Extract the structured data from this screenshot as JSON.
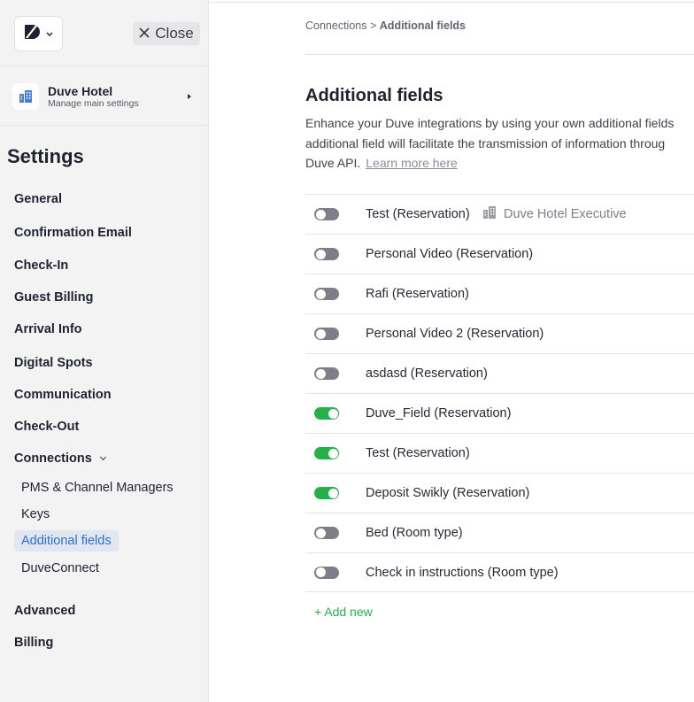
{
  "sidebar": {
    "close_label": "Close",
    "hotel": {
      "name": "Duve Hotel",
      "subtitle": "Manage main settings"
    },
    "title": "Settings",
    "items": [
      {
        "label": "General"
      },
      {
        "label": "Confirmation Email"
      },
      {
        "label": "Check-In"
      },
      {
        "label": "Guest Billing"
      },
      {
        "label": "Arrival Info"
      },
      {
        "label": "Digital Spots"
      },
      {
        "label": "Communication"
      },
      {
        "label": "Check-Out"
      },
      {
        "label": "Connections",
        "expanded": true
      },
      {
        "label": "Advanced"
      },
      {
        "label": "Billing"
      }
    ],
    "connections_sub": [
      {
        "label": "PMS & Channel Managers"
      },
      {
        "label": "Keys"
      },
      {
        "label": "Additional fields",
        "active": true
      },
      {
        "label": "DuveConnect"
      }
    ]
  },
  "breadcrumb": {
    "parent": "Connections",
    "separator": ">",
    "current": "Additional fields"
  },
  "page": {
    "title": "Additional fields",
    "description_lines": [
      "Enhance your Duve integrations by using your own additional fields",
      "additional field will facilitate the transmission of information throug",
      "Duve API."
    ],
    "learn_more": "Learn more here",
    "add_new": "+ Add new"
  },
  "fields": [
    {
      "label": "Test (Reservation)",
      "enabled": false,
      "scope": "Duve Hotel Executive"
    },
    {
      "label": "Personal Video (Reservation)",
      "enabled": false
    },
    {
      "label": "Rafi (Reservation)",
      "enabled": false
    },
    {
      "label": "Personal Video 2 (Reservation)",
      "enabled": false
    },
    {
      "label": "asdasd (Reservation)",
      "enabled": false
    },
    {
      "label": "Duve_Field (Reservation)",
      "enabled": true
    },
    {
      "label": "Test (Reservation)",
      "enabled": true
    },
    {
      "label": "Deposit Swikly (Reservation)",
      "enabled": true
    },
    {
      "label": "Bed (Room type)",
      "enabled": false
    },
    {
      "label": "Check in instructions (Room type)",
      "enabled": false
    }
  ],
  "colors": {
    "toggle_on": "#25b04b",
    "toggle_off": "#7c7f87",
    "active_link": "#2a6fd6",
    "add_new": "#25b04b"
  }
}
